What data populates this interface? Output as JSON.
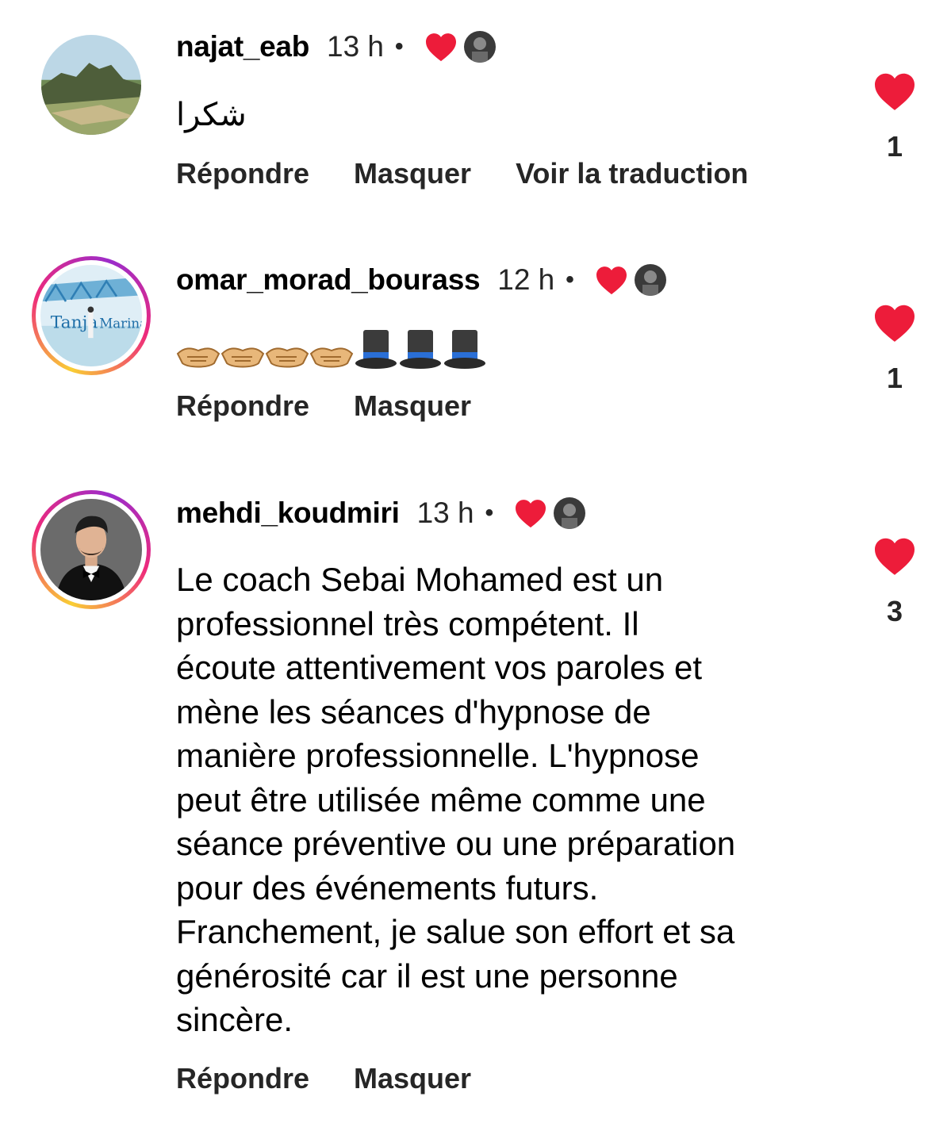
{
  "colors": {
    "heart": "#ed1c3a",
    "ring_start": "#f9ce34",
    "ring_mid": "#ee2a7b",
    "ring_end": "#9b2ccb"
  },
  "comments": [
    {
      "username": "najat_eab",
      "time": "13 h",
      "separator": "•",
      "text": "شكرا",
      "actions": {
        "reply": "Répondre",
        "hide": "Masquer",
        "translate": "Voir la traduction"
      },
      "likes": "1",
      "avatar_icon": "landscape-avatar-icon"
    },
    {
      "username": "omar_morad_bourass",
      "time": "12 h",
      "separator": "•",
      "emojis": [
        "handshake",
        "handshake",
        "handshake",
        "handshake",
        "top-hat",
        "top-hat",
        "top-hat"
      ],
      "actions": {
        "reply": "Répondre",
        "hide": "Masquer"
      },
      "likes": "1",
      "avatar_icon": "tanja-marina-avatar-icon",
      "avatar_text": "Tanja Marina"
    },
    {
      "username": "mehdi_koudmiri",
      "time": "13 h",
      "separator": "•",
      "text": "Le coach Sebai Mohamed est un professionnel très compétent. Il écoute attentivement vos paroles et mène les séances d'hypnose de manière professionnelle. L'hypnose peut être utilisée même comme une séance préventive ou une préparation pour des événements futurs. Franchement, je salue son effort et sa générosité car il est une personne sincère.",
      "text_lines": [
        "Le coach Sebai Mohamed est un",
        "professionnel très compétent. Il",
        "écoute attentivement vos paroles et",
        "mène les séances d'hypnose de",
        "manière professionnelle. L'hypnose",
        "peut être utilisée même comme une",
        "séance préventive ou une préparation",
        "pour des événements futurs.",
        "Franchement, je salue son effort et sa",
        "générosité car il est une personne",
        "sincère."
      ],
      "actions": {
        "reply": "Répondre",
        "hide": "Masquer"
      },
      "likes": "3",
      "avatar_icon": "man-in-tuxedo-avatar-icon"
    }
  ]
}
